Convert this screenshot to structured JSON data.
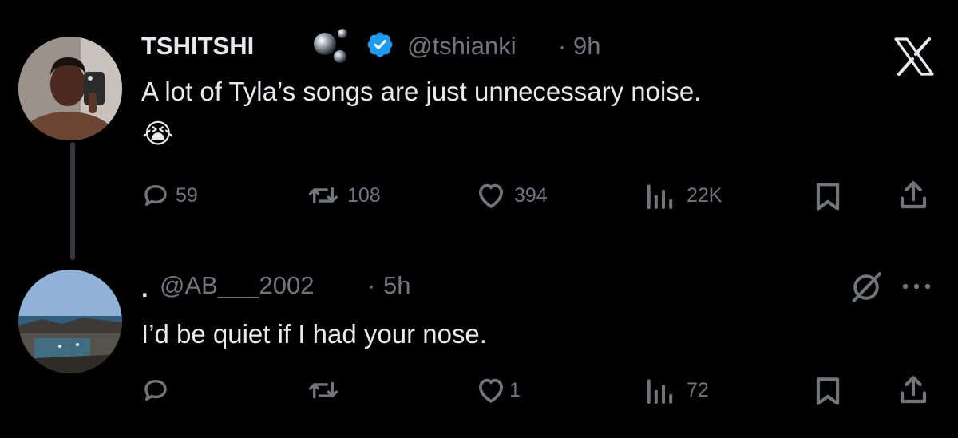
{
  "colors": {
    "background": "#000000",
    "primary_text": "#e7e9ea",
    "secondary_text": "#71767b",
    "verified_blue": "#1d9bf0",
    "thread_line": "#333639"
  },
  "tweet": {
    "author_name": "TSHITSHI",
    "name_decoration_icon": "bubbles-emoji",
    "verified_icon": "verified-badge-icon",
    "handle": "@tshianki",
    "separator": "·",
    "time": "9h",
    "text": "A lot of Tyla’s songs are just unnecessary noise.",
    "emoji": "😭",
    "brand_icon": "x-logo-icon",
    "stats": {
      "replies": "59",
      "retweets": "108",
      "likes": "394",
      "views": "22K"
    }
  },
  "reply": {
    "author_name": ".",
    "handle": "@AB___2002",
    "separator": "·",
    "time": "5h",
    "text": "I’d be quiet if I had your nose.",
    "muted_icon": "circle-slash-icon",
    "more_icon": "more-dots-icon",
    "stats": {
      "replies": "",
      "retweets": "",
      "likes": "1",
      "views": "72"
    }
  }
}
